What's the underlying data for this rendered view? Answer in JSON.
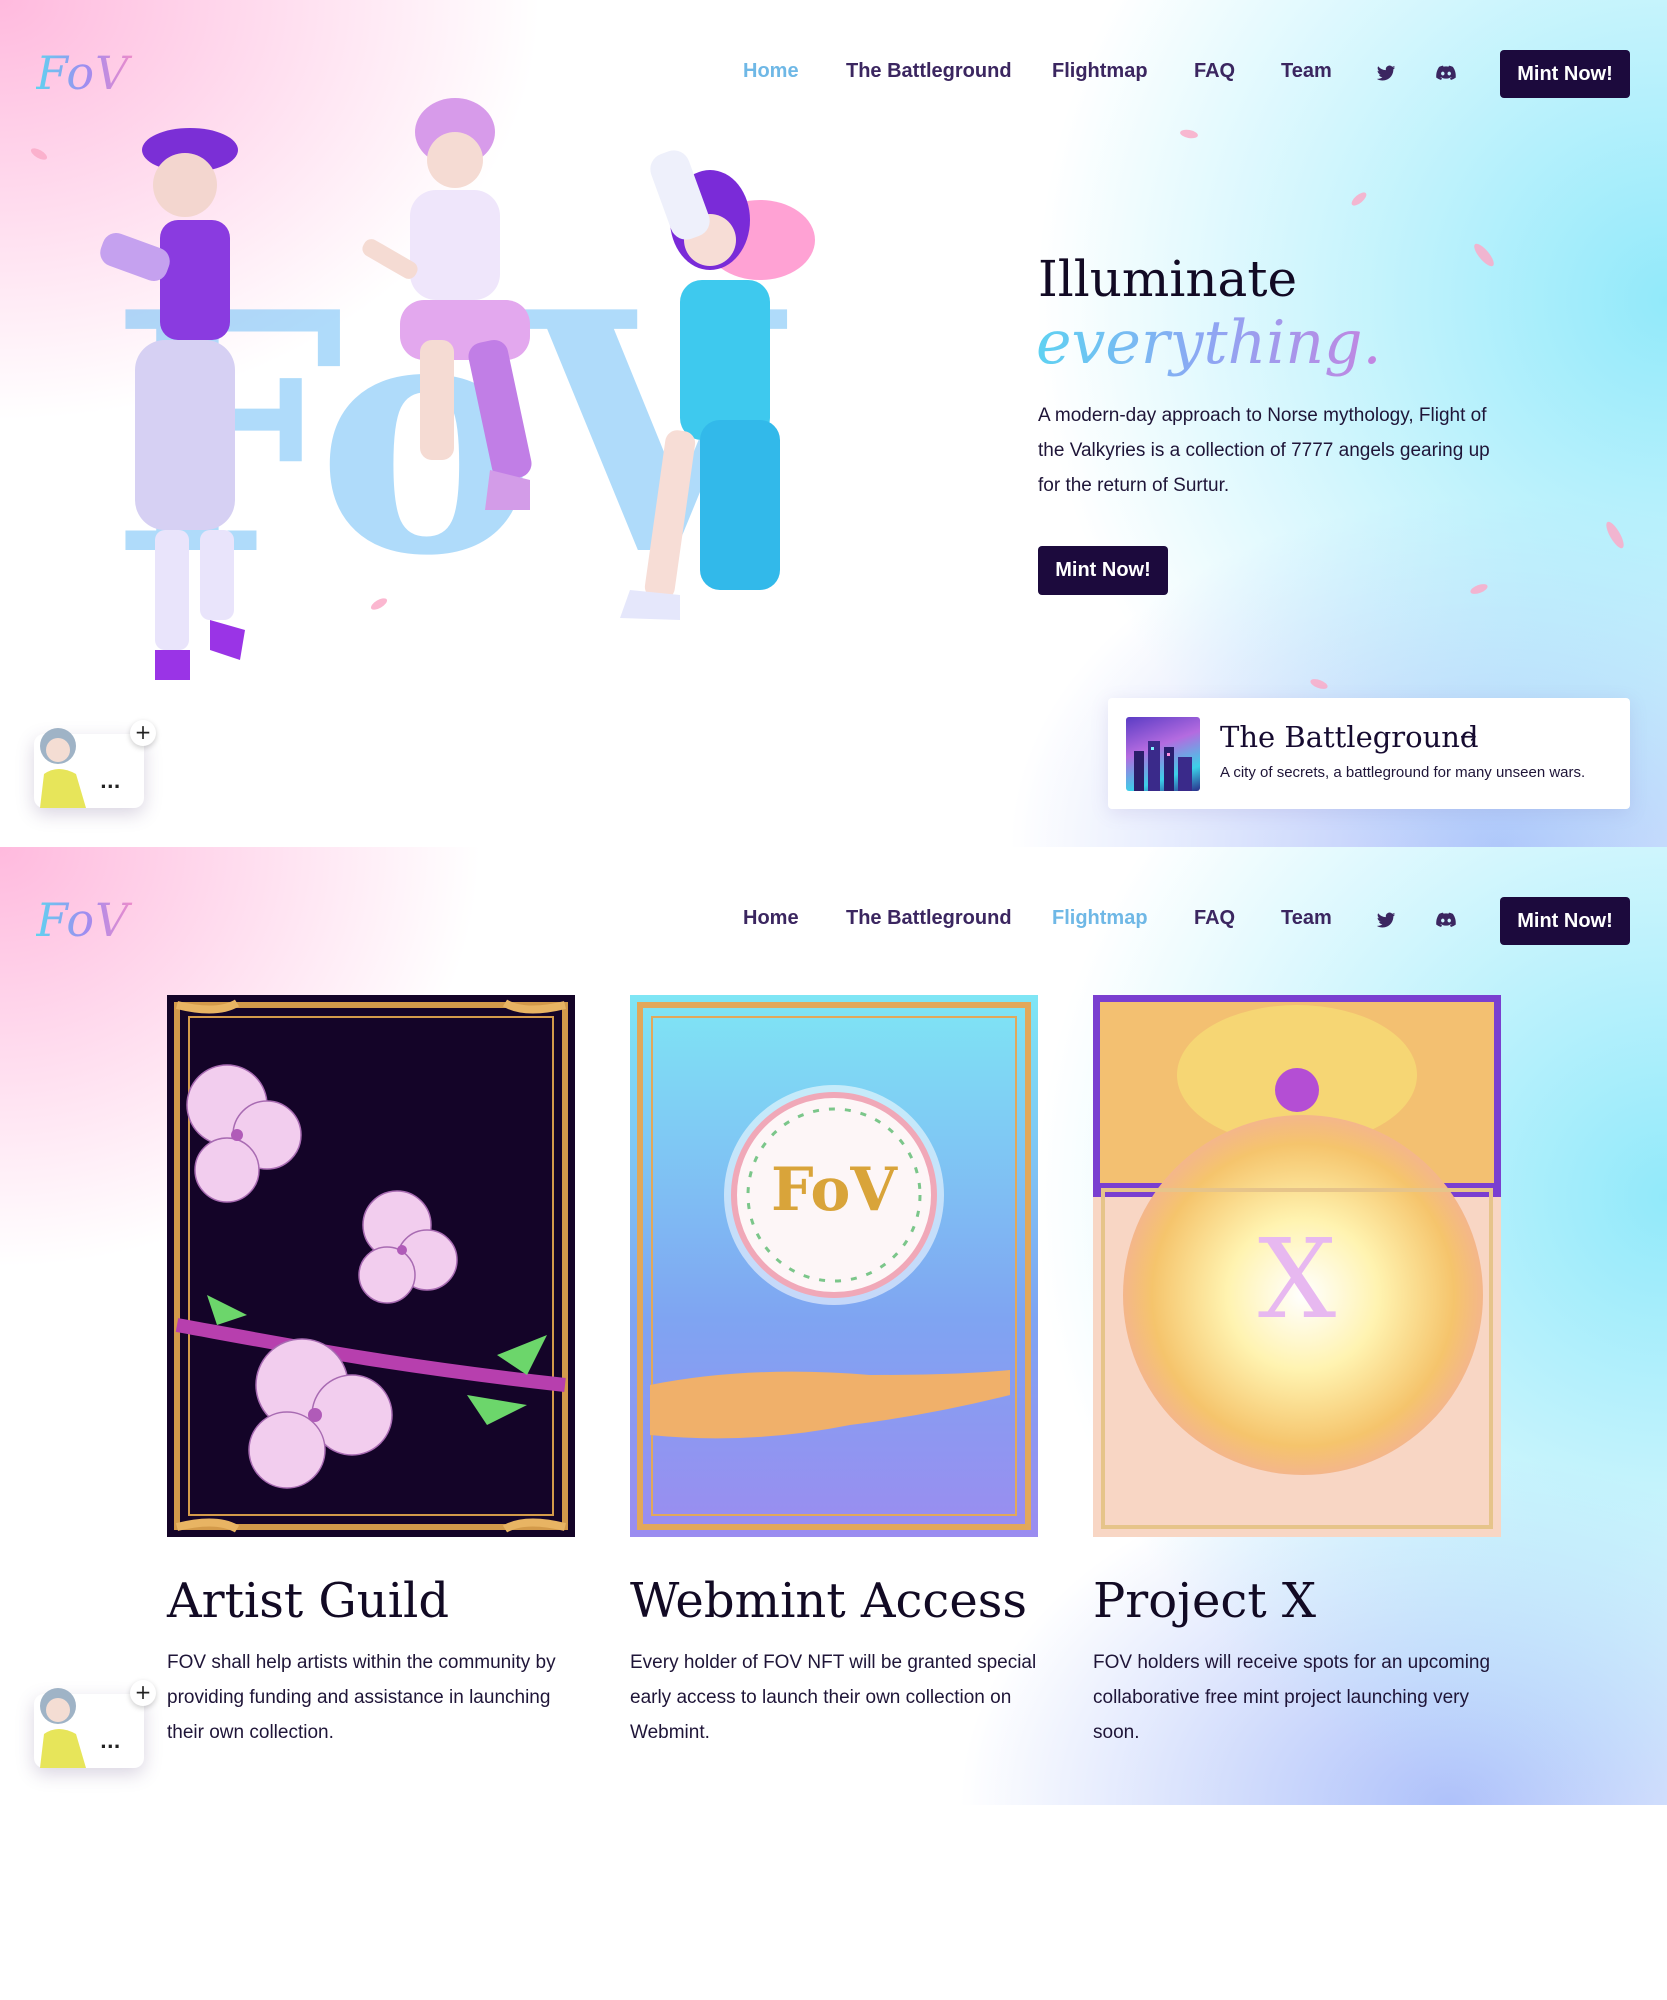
{
  "logo_text": "FoV",
  "nav": {
    "links": [
      "Home",
      "The Battleground",
      "Flightmap",
      "FAQ",
      "Team"
    ],
    "mint_label": "Mint Now!",
    "icons": [
      "twitter-icon",
      "discord-icon"
    ]
  },
  "hero": {
    "title_line1": "Illuminate",
    "title_line2": "everything.",
    "description": "A modern-day approach to Norse mythology, Flight of the Valkyries is a collection of 7777 angels gearing up for the return of Surtur.",
    "mint_label": "Mint Now!",
    "big_logo_text": "FoV",
    "battleground_card": {
      "title": "The Battleground",
      "arrow": "→",
      "subtitle": "A city of secrets, a battleground for many unseen wars."
    }
  },
  "widget": {
    "plus": "+",
    "dots": "..."
  },
  "features": [
    {
      "title": "Artist Guild",
      "description": "FOV shall help artists within the community by providing funding and assistance in launching their own collection."
    },
    {
      "title": "Webmint Access",
      "description": "Every holder of FOV NFT will be granted special early access to launch their own collection on Webmint.",
      "emblem_text": "FoV"
    },
    {
      "title": "Project X",
      "description": "FOV holders will receive spots for an upcoming collaborative free mint project launching very soon.",
      "emblem_text": "X"
    }
  ],
  "colors": {
    "dark_button": "#1c0a3d",
    "active_link": "#6fb8e6",
    "nav_text": "#3b2660",
    "pink_bg": "#ffb6dc",
    "cyan_bg": "#8ce8fa"
  }
}
